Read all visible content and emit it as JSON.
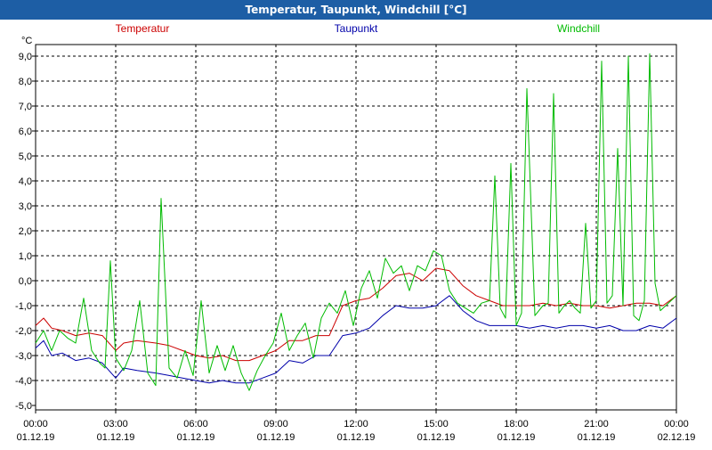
{
  "window": {
    "title": "Temperatur, Taupunkt, Windchill [°C]"
  },
  "chart_data": {
    "type": "line",
    "title": "Temperatur, Taupunkt, Windchill [°C]",
    "ylabel": "°C",
    "ylim": [
      -5.0,
      9.0
    ],
    "yticks": [
      "9,0",
      "8,0",
      "7,0",
      "6,0",
      "5,0",
      "4,0",
      "3,0",
      "2,0",
      "1,0",
      "0,0",
      "-1,0",
      "-2,0",
      "-3,0",
      "-4,0",
      "-5,0"
    ],
    "xlim": [
      0,
      24
    ],
    "xtick_hours": [
      0,
      3,
      6,
      9,
      12,
      15,
      18,
      21,
      24
    ],
    "xtick_time_labels": [
      "00:00",
      "03:00",
      "06:00",
      "09:00",
      "12:00",
      "15:00",
      "18:00",
      "21:00",
      "00:00"
    ],
    "xtick_date_labels": [
      "01.12.19",
      "01.12.19",
      "01.12.19",
      "01.12.19",
      "01.12.19",
      "01.12.19",
      "01.12.19",
      "01.12.19",
      "02.12.19"
    ],
    "grid": true,
    "legend_placement": "top",
    "series": [
      {
        "name": "Temperatur",
        "color": "#cc0000",
        "x": [
          0,
          0.3,
          0.6,
          1,
          1.5,
          2,
          2.5,
          3,
          3.3,
          3.8,
          4.5,
          5,
          5.5,
          6,
          6.5,
          7,
          7.5,
          8,
          8.5,
          9,
          9.5,
          10,
          10.5,
          11,
          11.5,
          12,
          12.5,
          13,
          13.5,
          14,
          14.5,
          15,
          15.5,
          16,
          16.5,
          17,
          17.5,
          18,
          18.5,
          19,
          19.5,
          20,
          20.5,
          21,
          21.5,
          22,
          22.5,
          23,
          23.5,
          24
        ],
        "values": [
          -1.8,
          -1.5,
          -1.9,
          -2.0,
          -2.2,
          -2.1,
          -2.2,
          -2.8,
          -2.5,
          -2.4,
          -2.5,
          -2.6,
          -2.8,
          -3.0,
          -3.1,
          -3.0,
          -3.2,
          -3.2,
          -3.0,
          -2.8,
          -2.4,
          -2.4,
          -2.2,
          -2.2,
          -1.0,
          -0.8,
          -0.7,
          -0.3,
          0.2,
          0.3,
          0.0,
          0.5,
          0.4,
          -0.2,
          -0.6,
          -0.8,
          -1.0,
          -1.0,
          -1.0,
          -0.9,
          -1.0,
          -0.9,
          -1.0,
          -1.0,
          -1.1,
          -1.0,
          -0.9,
          -0.9,
          -1.0,
          -0.6
        ]
      },
      {
        "name": "Taupunkt",
        "color": "#0000aa",
        "x": [
          0,
          0.3,
          0.6,
          1,
          1.5,
          2,
          2.5,
          3,
          3.3,
          3.8,
          4.5,
          5,
          5.5,
          6,
          6.5,
          7,
          7.5,
          8,
          8.5,
          9,
          9.5,
          10,
          10.5,
          11,
          11.5,
          12,
          12.5,
          13,
          13.5,
          14,
          14.5,
          15,
          15.5,
          16,
          16.5,
          17,
          17.5,
          18,
          18.5,
          19,
          19.5,
          20,
          20.5,
          21,
          21.5,
          22,
          22.5,
          23,
          23.5,
          24
        ],
        "values": [
          -2.7,
          -2.4,
          -3.0,
          -2.9,
          -3.2,
          -3.1,
          -3.3,
          -3.9,
          -3.5,
          -3.6,
          -3.7,
          -3.8,
          -3.9,
          -4.0,
          -4.1,
          -4.0,
          -4.1,
          -4.1,
          -3.9,
          -3.7,
          -3.2,
          -3.3,
          -3.0,
          -3.0,
          -2.2,
          -2.1,
          -1.9,
          -1.4,
          -1.0,
          -1.1,
          -1.1,
          -1.0,
          -0.6,
          -1.2,
          -1.6,
          -1.8,
          -1.8,
          -1.8,
          -1.9,
          -1.8,
          -1.9,
          -1.8,
          -1.8,
          -1.9,
          -1.8,
          -2.0,
          -2.0,
          -1.8,
          -1.9,
          -1.5
        ]
      },
      {
        "name": "Windchill",
        "color": "#00bb00",
        "x": [
          0,
          0.3,
          0.6,
          0.9,
          1.2,
          1.5,
          1.8,
          2.1,
          2.4,
          2.6,
          2.8,
          3.0,
          3.3,
          3.6,
          3.9,
          4.2,
          4.5,
          4.7,
          5.0,
          5.3,
          5.6,
          5.9,
          6.2,
          6.5,
          6.8,
          7.1,
          7.4,
          7.7,
          8.0,
          8.3,
          8.6,
          8.9,
          9.2,
          9.5,
          9.8,
          10.1,
          10.4,
          10.7,
          11.0,
          11.3,
          11.6,
          11.9,
          12.2,
          12.5,
          12.8,
          13.1,
          13.4,
          13.7,
          14.0,
          14.3,
          14.6,
          14.9,
          15.2,
          15.5,
          15.8,
          16.1,
          16.4,
          16.7,
          17.0,
          17.2,
          17.4,
          17.6,
          17.8,
          18.0,
          18.2,
          18.4,
          18.7,
          19.0,
          19.2,
          19.4,
          19.6,
          19.8,
          20.0,
          20.2,
          20.4,
          20.6,
          20.8,
          21.0,
          21.2,
          21.4,
          21.6,
          21.8,
          22.0,
          22.2,
          22.4,
          22.6,
          22.8,
          23.0,
          23.2,
          23.4,
          23.6,
          23.8,
          24.0
        ],
        "values": [
          -2.5,
          -2.0,
          -2.8,
          -2.0,
          -2.3,
          -2.5,
          -0.7,
          -2.8,
          -3.3,
          -3.5,
          0.8,
          -3.1,
          -3.6,
          -2.8,
          -0.8,
          -3.7,
          -4.2,
          3.3,
          -3.5,
          -3.9,
          -2.8,
          -3.8,
          -0.8,
          -3.7,
          -2.6,
          -3.6,
          -2.6,
          -3.7,
          -4.4,
          -3.6,
          -3.0,
          -2.5,
          -1.3,
          -2.8,
          -2.2,
          -1.7,
          -3.1,
          -1.5,
          -0.9,
          -1.3,
          -0.4,
          -1.8,
          -0.3,
          0.4,
          -0.7,
          0.9,
          0.3,
          0.6,
          -0.4,
          0.6,
          0.4,
          1.2,
          1.0,
          -0.4,
          -0.9,
          -1.1,
          -1.3,
          -0.9,
          -0.8,
          4.2,
          -1.1,
          -1.5,
          4.7,
          -1.8,
          -1.3,
          7.7,
          -1.4,
          -1.0,
          -0.9,
          7.5,
          -1.3,
          -1.0,
          -0.8,
          -1.1,
          -1.3,
          2.3,
          -1.1,
          -0.8,
          8.8,
          -0.9,
          -0.6,
          5.3,
          -1.0,
          9.0,
          -1.4,
          -1.6,
          -0.8,
          9.1,
          -0.1,
          -1.2,
          -1.0,
          -0.8,
          -0.6
        ]
      }
    ]
  }
}
